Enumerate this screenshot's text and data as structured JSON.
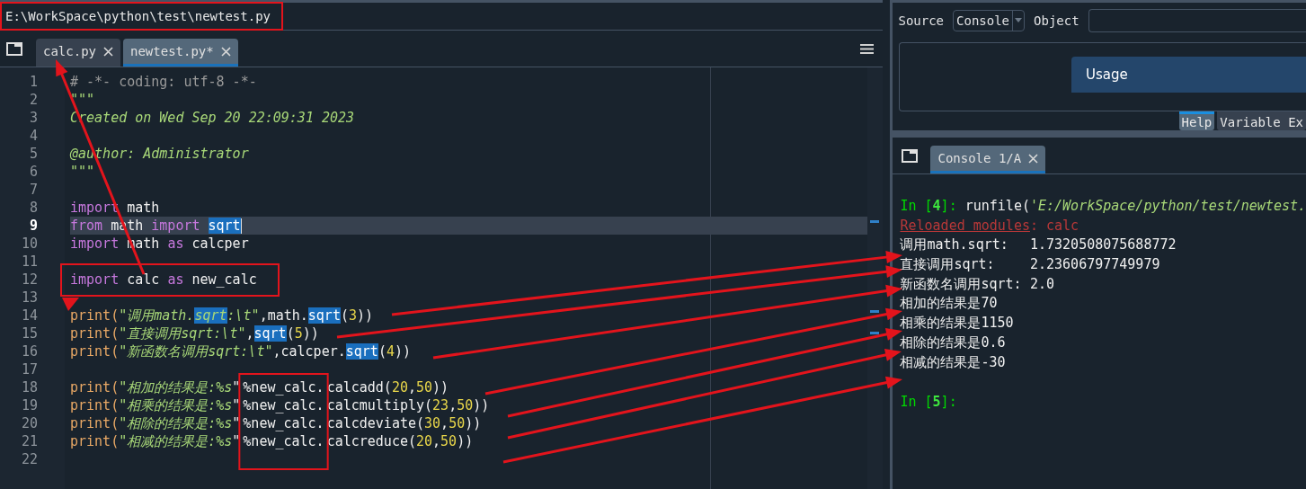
{
  "path_bar": {
    "path": "E:\\WorkSpace\\python\\test\\newtest.py"
  },
  "editor": {
    "tabs": [
      {
        "label": "calc.py",
        "selected": false
      },
      {
        "label": "newtest.py*",
        "selected": true
      }
    ],
    "lines": [
      {
        "number": "1",
        "current": false,
        "tokens": [
          {
            "kind": "comment",
            "text": "# -*- coding: utf-8 -*-"
          }
        ]
      },
      {
        "number": "2",
        "current": false,
        "tokens": [
          {
            "kind": "doc",
            "text": "\"\"\""
          }
        ]
      },
      {
        "number": "3",
        "current": false,
        "tokens": [
          {
            "kind": "doc",
            "text": "Created on Wed Sep 20 22:09:31 2023"
          }
        ]
      },
      {
        "number": "4",
        "current": false
      },
      {
        "number": "5",
        "current": false,
        "tokens": [
          {
            "kind": "doc",
            "text": "@author: Administrator"
          }
        ]
      },
      {
        "number": "6",
        "current": false,
        "tokens": [
          {
            "kind": "doc",
            "text": "\"\"\""
          }
        ]
      },
      {
        "number": "7",
        "current": false
      },
      {
        "number": "8",
        "current": false,
        "tokens": [
          {
            "kind": "keyword",
            "text": "import"
          },
          {
            "kind": "name",
            "text": " math"
          }
        ]
      },
      {
        "number": "9",
        "current": true,
        "tokens": [
          {
            "kind": "keyword",
            "text": "from"
          },
          {
            "kind": "name",
            "text": " math "
          },
          {
            "kind": "keyword",
            "text": "import "
          },
          {
            "kind": "match",
            "text": "sqrt"
          }
        ]
      },
      {
        "number": "10",
        "current": false,
        "tokens": [
          {
            "kind": "keyword",
            "text": "import"
          },
          {
            "kind": "name",
            "text": " math "
          },
          {
            "kind": "keyword",
            "text": "as"
          },
          {
            "kind": "name",
            "text": " calcper"
          }
        ]
      },
      {
        "number": "11",
        "current": false
      },
      {
        "number": "12",
        "current": false,
        "tokens": [
          {
            "kind": "keyword",
            "text": "import"
          },
          {
            "kind": "name",
            "text": " calc "
          },
          {
            "kind": "keyword",
            "text": "as"
          },
          {
            "kind": "name",
            "text": " new_calc"
          }
        ]
      },
      {
        "number": "13",
        "current": false
      },
      {
        "number": "14",
        "current": false,
        "tokens": [
          {
            "kind": "func",
            "text": "print("
          },
          {
            "kind": "string",
            "text": "\"调用math."
          },
          {
            "kind": "string-match",
            "text": "sqrt"
          },
          {
            "kind": "string",
            "text": ":\\t\""
          },
          {
            "kind": "name",
            "text": ",math."
          },
          {
            "kind": "match",
            "text": "sqrt"
          },
          {
            "kind": "name",
            "text": "("
          },
          {
            "kind": "number",
            "text": "3"
          },
          {
            "kind": "name",
            "text": "))"
          }
        ]
      },
      {
        "number": "15",
        "current": false,
        "tokens": [
          {
            "kind": "func",
            "text": "print("
          },
          {
            "kind": "string",
            "text": "\"直接调用sqrt:\\t\""
          },
          {
            "kind": "name",
            "text": ","
          },
          {
            "kind": "match",
            "text": "sqrt"
          },
          {
            "kind": "name",
            "text": "("
          },
          {
            "kind": "number",
            "text": "5"
          },
          {
            "kind": "name",
            "text": "))"
          }
        ]
      },
      {
        "number": "16",
        "current": false,
        "tokens": [
          {
            "kind": "func",
            "text": "print("
          },
          {
            "kind": "string",
            "text": "\"新函数名调用sqrt:\\t\""
          },
          {
            "kind": "name",
            "text": ",calcper."
          },
          {
            "kind": "match",
            "text": "sqrt"
          },
          {
            "kind": "name",
            "text": "("
          },
          {
            "kind": "number",
            "text": "4"
          },
          {
            "kind": "name",
            "text": "))"
          }
        ]
      },
      {
        "number": "17",
        "current": false
      },
      {
        "number": "18",
        "current": false,
        "tokens": [
          {
            "kind": "func",
            "text": "print("
          },
          {
            "kind": "string",
            "text": "\"相加的结果是:%s"
          },
          {
            "kind": "name",
            "text": "\""
          },
          {
            "kind": "name",
            "text": "%new_calc.",
            "framed": true
          },
          {
            "kind": "name",
            "text": "calcadd("
          },
          {
            "kind": "number",
            "text": "20"
          },
          {
            "kind": "name",
            "text": ","
          },
          {
            "kind": "number",
            "text": "50"
          },
          {
            "kind": "name",
            "text": "))"
          }
        ]
      },
      {
        "number": "19",
        "current": false,
        "tokens": [
          {
            "kind": "func",
            "text": "print("
          },
          {
            "kind": "string",
            "text": "\"相乘的结果是:%s"
          },
          {
            "kind": "name",
            "text": "\""
          },
          {
            "kind": "name",
            "text": "%new_calc.",
            "framed": true
          },
          {
            "kind": "name",
            "text": "calcmultiply("
          },
          {
            "kind": "number",
            "text": "23"
          },
          {
            "kind": "name",
            "text": ","
          },
          {
            "kind": "number",
            "text": "50"
          },
          {
            "kind": "name",
            "text": "))"
          }
        ]
      },
      {
        "number": "20",
        "current": false,
        "tokens": [
          {
            "kind": "func",
            "text": "print("
          },
          {
            "kind": "string",
            "text": "\"相除的结果是:%s"
          },
          {
            "kind": "name",
            "text": "\""
          },
          {
            "kind": "name",
            "text": "%new_calc.",
            "framed": true
          },
          {
            "kind": "name",
            "text": "calcdeviate("
          },
          {
            "kind": "number",
            "text": "30"
          },
          {
            "kind": "name",
            "text": ","
          },
          {
            "kind": "number",
            "text": "50"
          },
          {
            "kind": "name",
            "text": "))"
          }
        ]
      },
      {
        "number": "21",
        "current": false,
        "tokens": [
          {
            "kind": "func",
            "text": "print("
          },
          {
            "kind": "string",
            "text": "\"相减的结果是:%s"
          },
          {
            "kind": "name",
            "text": "\""
          },
          {
            "kind": "name",
            "text": "%new_calc.",
            "framed": true
          },
          {
            "kind": "name",
            "text": "calcreduce("
          },
          {
            "kind": "number",
            "text": "20"
          },
          {
            "kind": "name",
            "text": ","
          },
          {
            "kind": "number",
            "text": "50"
          },
          {
            "kind": "name",
            "text": "))"
          }
        ]
      },
      {
        "number": "22",
        "current": false
      }
    ]
  },
  "help": {
    "source_label": "Source",
    "source_value": "Console",
    "object_label": "Object",
    "usage_title": "Usage",
    "tabs": [
      {
        "label": "Help",
        "selected": true
      },
      {
        "label": "Variable Ex",
        "selected": false
      }
    ]
  },
  "console": {
    "tab": "Console 1/A",
    "lines": [
      {
        "kind": "prompt",
        "tokens": [
          {
            "kind": "prompt",
            "text": "In ["
          },
          {
            "kind": "count",
            "text": "4"
          },
          {
            "kind": "prompt",
            "text": "]: "
          },
          {
            "kind": "name",
            "text": "runfile("
          },
          {
            "kind": "string",
            "text": "'E:/WorkSpace/python/test/newtest."
          }
        ]
      },
      {
        "kind": "message",
        "tokens": [
          {
            "kind": "error-link",
            "text": "Reloaded modules"
          },
          {
            "kind": "error",
            "text": ": calc"
          }
        ]
      },
      {
        "tokens": [
          {
            "kind": "output",
            "text": "调用math.sqrt:\t1.7320508075688772"
          }
        ]
      },
      {
        "tokens": [
          {
            "kind": "output",
            "text": "直接调用sqrt:\t2.23606797749979"
          }
        ]
      },
      {
        "tokens": [
          {
            "kind": "output",
            "text": "新函数名调用sqrt:\t2.0"
          }
        ]
      },
      {
        "tokens": [
          {
            "kind": "output",
            "text": "相加的结果是70"
          }
        ]
      },
      {
        "tokens": [
          {
            "kind": "output",
            "text": "相乘的结果是1150"
          }
        ]
      },
      {
        "tokens": [
          {
            "kind": "output",
            "text": "相除的结果是0.6"
          }
        ]
      },
      {
        "tokens": [
          {
            "kind": "output",
            "text": "相减的结果是-30"
          }
        ]
      },
      {
        "kind": "prompt",
        "tokens": [
          {
            "kind": "prompt",
            "text": "In ["
          },
          {
            "kind": "count",
            "text": "5"
          },
          {
            "kind": "prompt",
            "text": "]: "
          }
        ]
      }
    ]
  }
}
